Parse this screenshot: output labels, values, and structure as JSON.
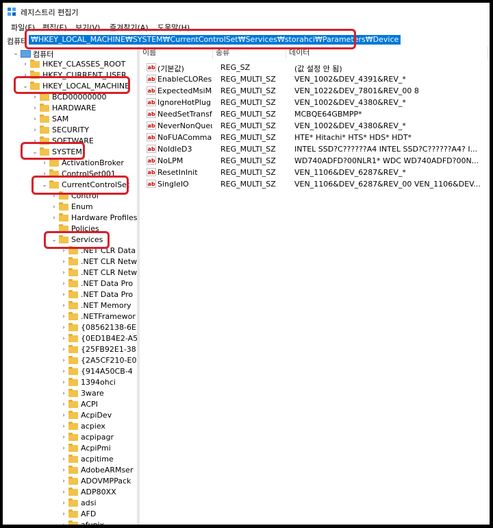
{
  "window": {
    "title": "레지스트리 편집기"
  },
  "menu": [
    "파일(F)",
    "편집(E)",
    "보기(V)",
    "즐겨찾기(A)",
    "도움말(H)"
  ],
  "address": {
    "label": "컴퓨터",
    "path": "₩HKEY_LOCAL_MACHINE₩SYSTEM₩CurrentControlSet₩Services₩storahci₩Parameters₩Device"
  },
  "tree": {
    "root": "컴퓨터",
    "hives": [
      "HKEY_CLASSES_ROOT",
      "HKEY_CURRENT_USER",
      "HKEY_LOCAL_MACHINE"
    ],
    "hklm_children": [
      "BCD00000000",
      "HARDWARE",
      "SAM",
      "SECURITY",
      "SOFTWARE",
      "SYSTEM"
    ],
    "system_children": [
      "ActivationBroker",
      "ControlSet001",
      "CurrentControlSet"
    ],
    "ccs_children": [
      "Control",
      "Enum",
      "Hardware Profiles",
      "Policies",
      "Services"
    ],
    "services": [
      ".NET CLR Data",
      ".NET CLR Netw",
      ".NET CLR Netw",
      ".NET Data Pro",
      ".NET Data Pro",
      ".NET Memory",
      ".NETFramewor",
      "{08562138-6E",
      "{0ED1B4E2-A5",
      "{25FB92E1-38",
      "{2A5CF210-E0",
      "{914A50CB-4",
      "1394ohci",
      "3ware",
      "ACPI",
      "AcpiDev",
      "acpiex",
      "acpipagr",
      "AcpiPmi",
      "acpitime",
      "AdobeARMser",
      "ADOVMPPack",
      "ADP80XX",
      "adsi",
      "AFD",
      "afunix"
    ]
  },
  "columns": {
    "name": "이름",
    "type": "종류",
    "data": "데이터"
  },
  "values": [
    {
      "name": "(기본값)",
      "type": "REG_SZ",
      "data": "(값 설정 안 됨)"
    },
    {
      "name": "EnableCLOReset",
      "type": "REG_MULTI_SZ",
      "data": "VEN_1002&DEV_4391&REV_*"
    },
    {
      "name": "ExpectedMsiMe...",
      "type": "REG_MULTI_SZ",
      "data": "VEN_1022&DEV_7801&REV_00 8"
    },
    {
      "name": "IgnoreHotPlug",
      "type": "REG_MULTI_SZ",
      "data": "VEN_1002&DEV_4380&REV_*"
    },
    {
      "name": "NeedSetTransfer...",
      "type": "REG_MULTI_SZ",
      "data": "MCBQE64GBMPP*"
    },
    {
      "name": "NeverNonQueu...",
      "type": "REG_MULTI_SZ",
      "data": "VEN_1002&DEV_4380&REV_*"
    },
    {
      "name": "NoFUACommand",
      "type": "REG_MULTI_SZ",
      "data": "HTE* Hitachi* HTS* HDS* HDT*"
    },
    {
      "name": "NoIdleD3",
      "type": "REG_MULTI_SZ",
      "data": "INTEL SSD?C??????A4 INTEL SSD?C??????A4? I..."
    },
    {
      "name": "NoLPM",
      "type": "REG_MULTI_SZ",
      "data": "WD740ADFD?00NLR1* WDC WD740ADFD?00N..."
    },
    {
      "name": "ResetInInit",
      "type": "REG_MULTI_SZ",
      "data": "VEN_1106&DEV_6287&REV_*"
    },
    {
      "name": "SingleIO",
      "type": "REG_MULTI_SZ",
      "data": "VEN_1106&DEV_6287&REV_00 VEN_1106&DEV..."
    }
  ],
  "value_icon": "ab"
}
